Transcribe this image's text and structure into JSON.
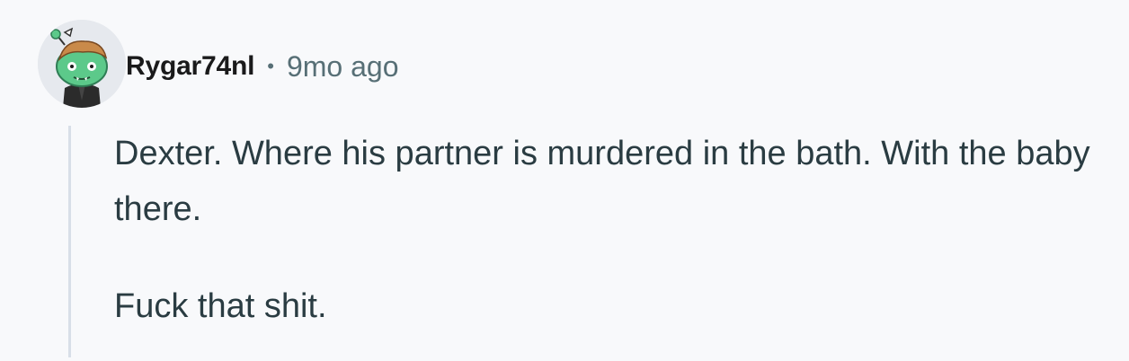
{
  "comment": {
    "author": "Rygar74nl",
    "separator": "•",
    "timestamp": "9mo ago",
    "avatar_icon": "snoo-avatar-icon",
    "paragraphs": [
      "Dexter. Where his partner is murdered in the bath. With the baby there.",
      "Fuck that shit."
    ]
  },
  "colors": {
    "background": "#f8f9fb",
    "username": "#1a1a1b",
    "meta": "#576f76",
    "body_text": "#2a3c42",
    "thread_line": "#d8dfe8",
    "avatar_green": "#5cc98a"
  }
}
